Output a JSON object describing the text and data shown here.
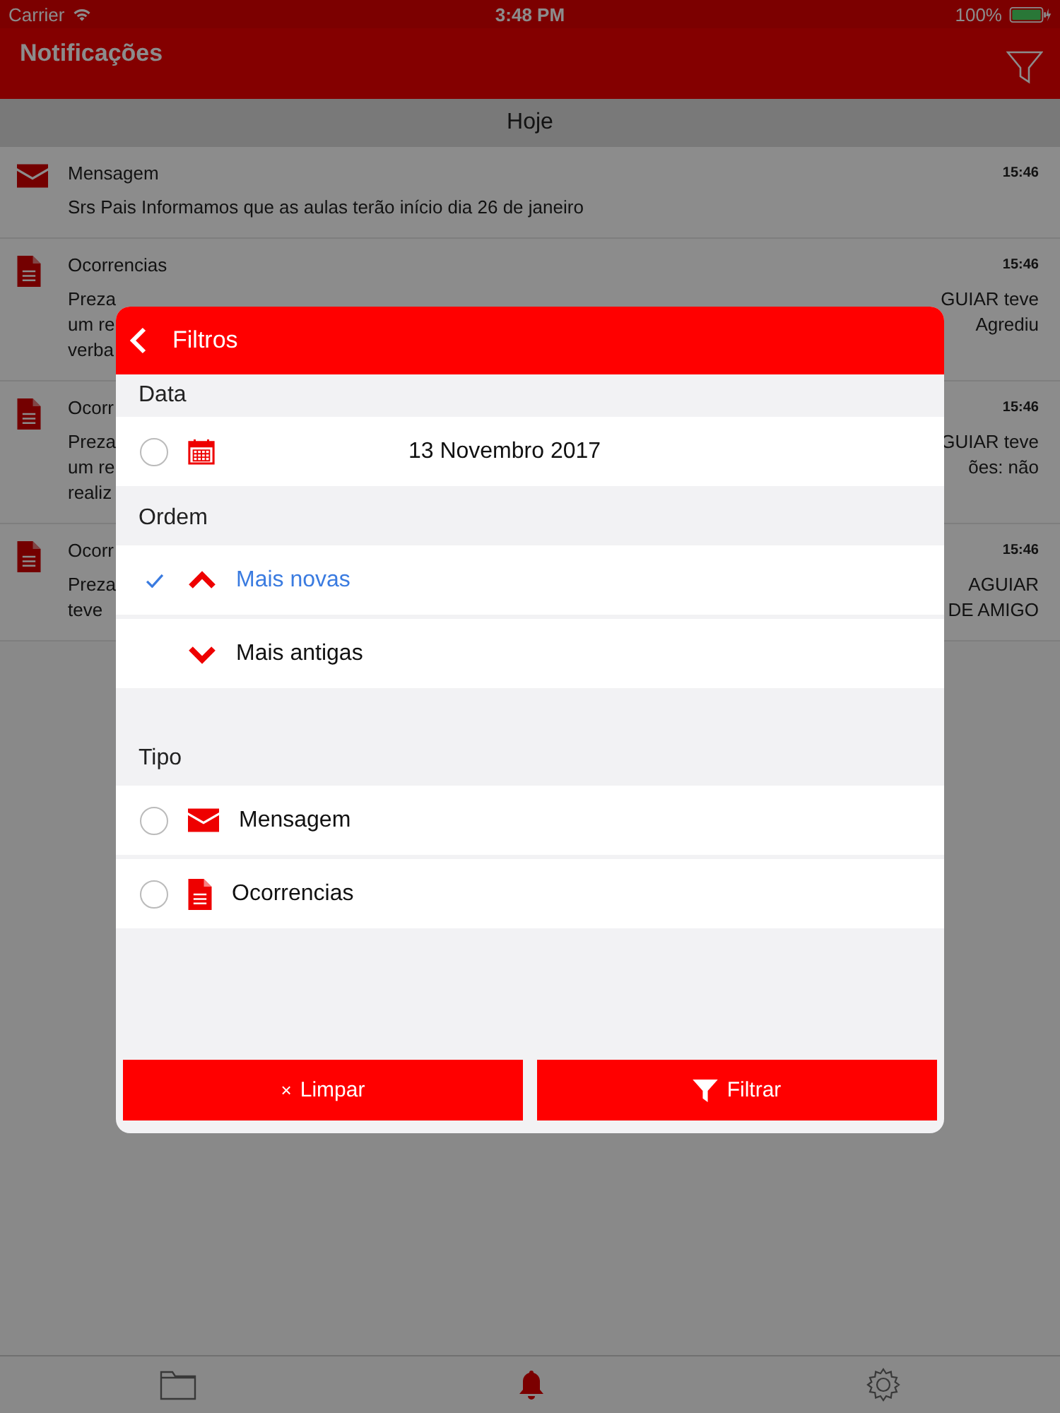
{
  "status_bar": {
    "carrier": "Carrier",
    "time": "3:48 PM",
    "battery": "100%"
  },
  "header": {
    "title": "Notificações"
  },
  "section": "Hoje",
  "notifications": [
    {
      "kind": "message",
      "title": "Mensagem",
      "time": "15:46",
      "body_left": [
        "Srs Pais Informamos que as aulas terão início dia 26 de janeiro"
      ]
    },
    {
      "kind": "document",
      "title": "Ocorrencias",
      "time": "15:46",
      "body_left": [
        "Preza",
        "um re",
        "verba"
      ],
      "body_right": [
        "GUIAR teve",
        "Agrediu"
      ]
    },
    {
      "kind": "document",
      "title": "Ocorr",
      "time": "15:46",
      "body_left": [
        "Preza",
        "um re",
        "realiz"
      ],
      "body_right": [
        "GUIAR teve",
        "ões: não"
      ]
    },
    {
      "kind": "document",
      "title": "Ocorr",
      "time": "15:46",
      "body_left": [
        "Preza",
        "teve"
      ],
      "body_right": [
        "AGUIAR",
        "DE AMIGO"
      ]
    }
  ],
  "dialog": {
    "title": "Filtros",
    "date_section": "Data",
    "date": {
      "checked": false,
      "value": "13 Novembro 2017"
    },
    "order_section": "Ordem",
    "order_options": [
      {
        "label": "Mais novas",
        "kind": "up",
        "selected": true
      },
      {
        "label": "Mais antigas",
        "kind": "down",
        "selected": false
      }
    ],
    "type_section": "Tipo",
    "type_options": [
      {
        "label": "Mensagem",
        "kind": "message",
        "checked": false
      },
      {
        "label": "Ocorrencias",
        "kind": "document",
        "checked": false
      }
    ],
    "clear_button": {
      "icon": "×",
      "label": "Limpar"
    },
    "filter_button": "Filtrar"
  },
  "tab_bar": [
    {
      "kind": "folder",
      "selected": false
    },
    {
      "kind": "bell",
      "selected": true
    },
    {
      "kind": "gear",
      "selected": false
    }
  ]
}
